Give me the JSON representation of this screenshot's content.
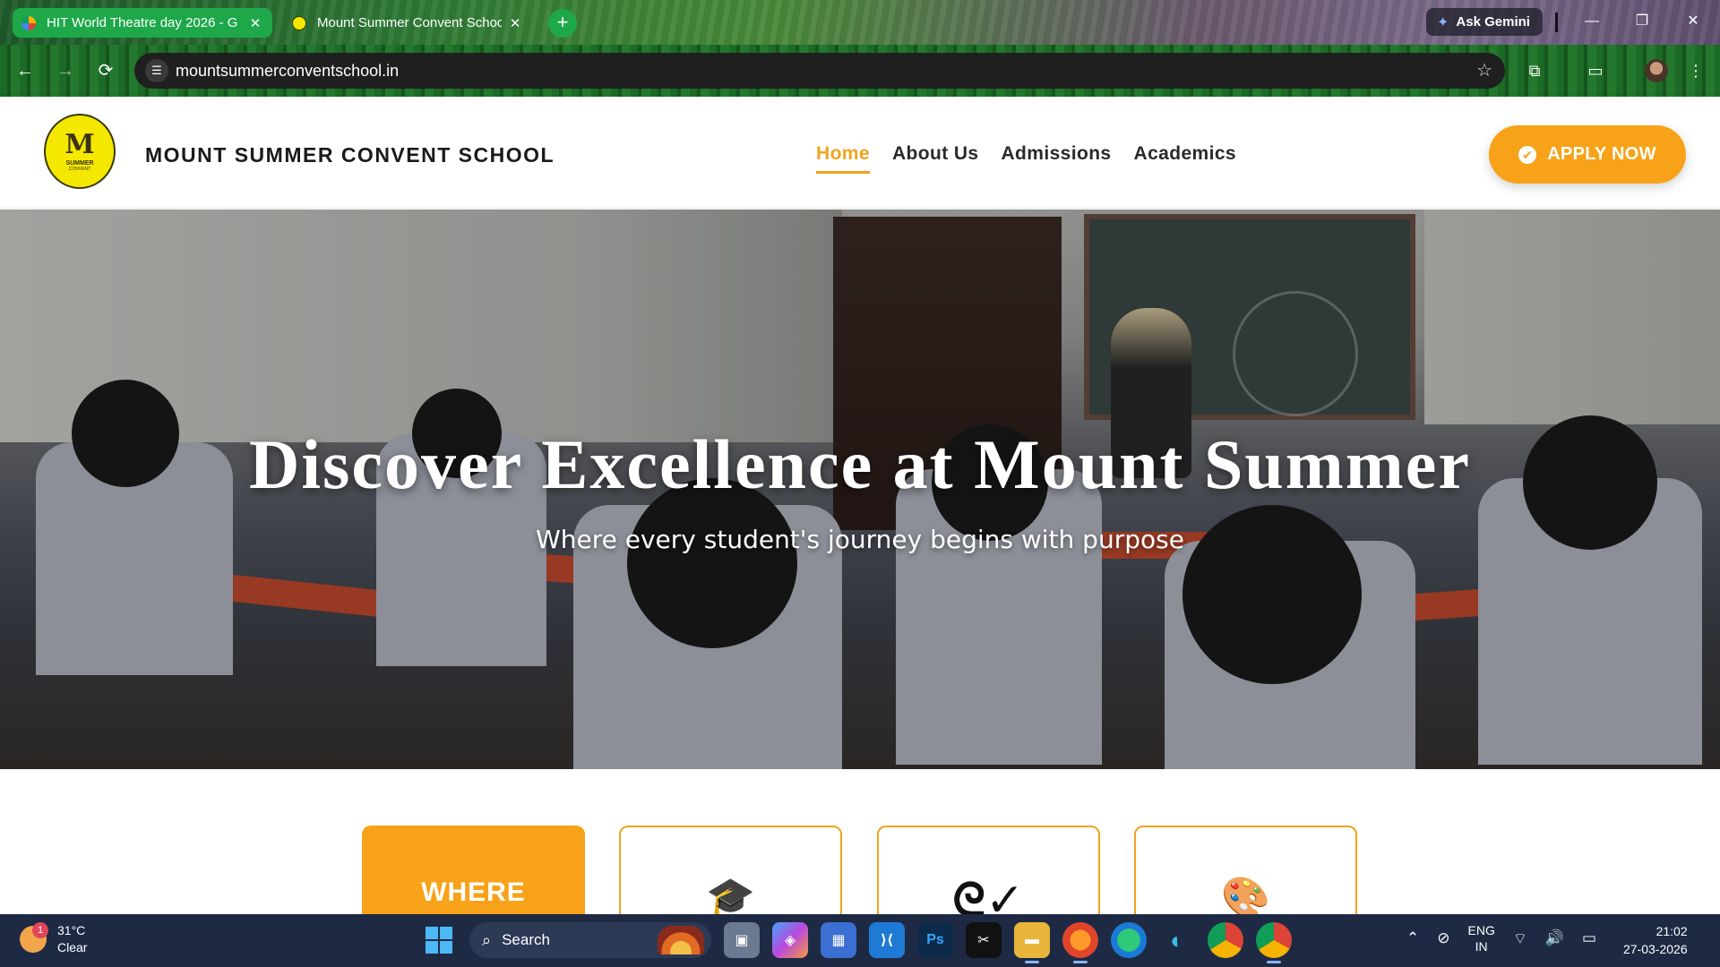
{
  "browser": {
    "tabs": [
      {
        "title": "HIT World Theatre day 2026 - G",
        "active": true
      },
      {
        "title": "Mount Summer Convent Schoo",
        "active": false
      }
    ],
    "new_tab_symbol": "+",
    "ask_gemini": "Ask Gemini",
    "url": "mountsummerconventschool.in",
    "window_controls": {
      "minimize": "—",
      "restore": "❐",
      "close": "✕"
    },
    "nav": {
      "back": "←",
      "forward": "→",
      "reload": "⟳"
    }
  },
  "site": {
    "logo": {
      "mark": "M",
      "word": "SUMMER",
      "word2": "CONVENT"
    },
    "name": "MOUNT SUMMER CONVENT SCHOOL",
    "menu": [
      {
        "label": "Home",
        "active": true
      },
      {
        "label": "About Us",
        "active": false
      },
      {
        "label": "Admissions",
        "active": false
      },
      {
        "label": "Academics",
        "active": false
      }
    ],
    "apply_button": "APPLY NOW",
    "colors": {
      "accent": "#f7a218",
      "text": "#2a2a2a"
    }
  },
  "hero": {
    "title": "Discover Excellence at Mount Summer",
    "subtitle": "Where every student's journey begins with purpose"
  },
  "cards": [
    {
      "label": "WHERE",
      "icon": "mortarboard-icon"
    },
    {
      "icon": "graduation-cap-icon"
    },
    {
      "icon": "people-icon"
    },
    {
      "icon": "art-palette-icon"
    }
  ],
  "taskbar": {
    "weather": {
      "temp": "31°C",
      "condition": "Clear",
      "badge": "1"
    },
    "search_label": "Search",
    "lang": {
      "line1": "ENG",
      "line2": "IN"
    },
    "clock": {
      "time": "21:02",
      "date": "27-03-2026"
    }
  }
}
